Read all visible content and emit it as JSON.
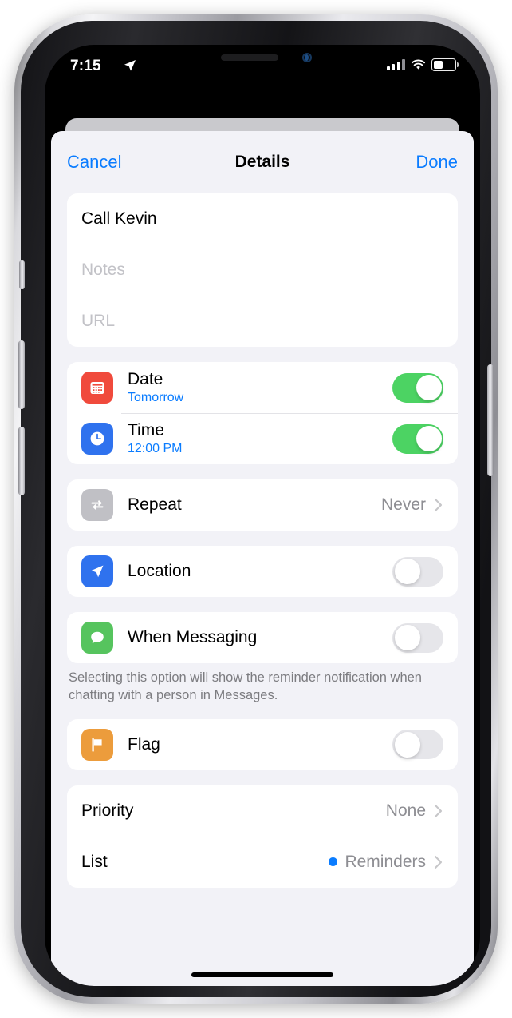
{
  "status_bar": {
    "time": "7:15",
    "location_icon": "location-arrow-icon",
    "signal_icon": "cellular-signal-icon",
    "signal_bars_filled": 3,
    "wifi_icon": "wifi-icon",
    "battery_icon": "battery-icon",
    "battery_percent": 40
  },
  "nav": {
    "cancel_label": "Cancel",
    "title": "Details",
    "done_label": "Done"
  },
  "text_fields": {
    "title_value": "Call Kevin",
    "notes_placeholder": "Notes",
    "url_placeholder": "URL"
  },
  "datetime": {
    "date": {
      "icon": "calendar-icon",
      "icon_color": "#f04a3c",
      "label": "Date",
      "value": "Tomorrow",
      "toggle_on": true
    },
    "time": {
      "icon": "clock-icon",
      "icon_color": "#2f72ee",
      "label": "Time",
      "value": "12:00 PM",
      "toggle_on": true
    }
  },
  "repeat": {
    "icon": "repeat-icon",
    "icon_color": "#c0c0c5",
    "label": "Repeat",
    "value": "Never",
    "chevron": "chevron-right-icon"
  },
  "location": {
    "icon": "location-arrow-icon",
    "icon_color": "#2f72ee",
    "label": "Location",
    "toggle_on": false
  },
  "messaging": {
    "icon": "message-bubble-icon",
    "icon_color": "#56c45e",
    "label": "When Messaging",
    "toggle_on": false,
    "footnote": "Selecting this option will show the reminder notification when chatting with a person in Messages."
  },
  "flag": {
    "icon": "flag-icon",
    "icon_color": "#ec9c3c",
    "label": "Flag",
    "toggle_on": false
  },
  "priority": {
    "label": "Priority",
    "value": "None",
    "chevron": "chevron-right-icon"
  },
  "list": {
    "label": "List",
    "dot_color": "#0a7cff",
    "value": "Reminders",
    "chevron": "chevron-right-icon"
  },
  "theme": {
    "accent_blue": "#0a7cff",
    "toggle_on_green": "#4cd363",
    "toggle_off_gray": "#e6e6ea",
    "group_bg": "#f2f2f7",
    "card_bg": "#ffffff",
    "secondary_text": "#8e8e93"
  }
}
